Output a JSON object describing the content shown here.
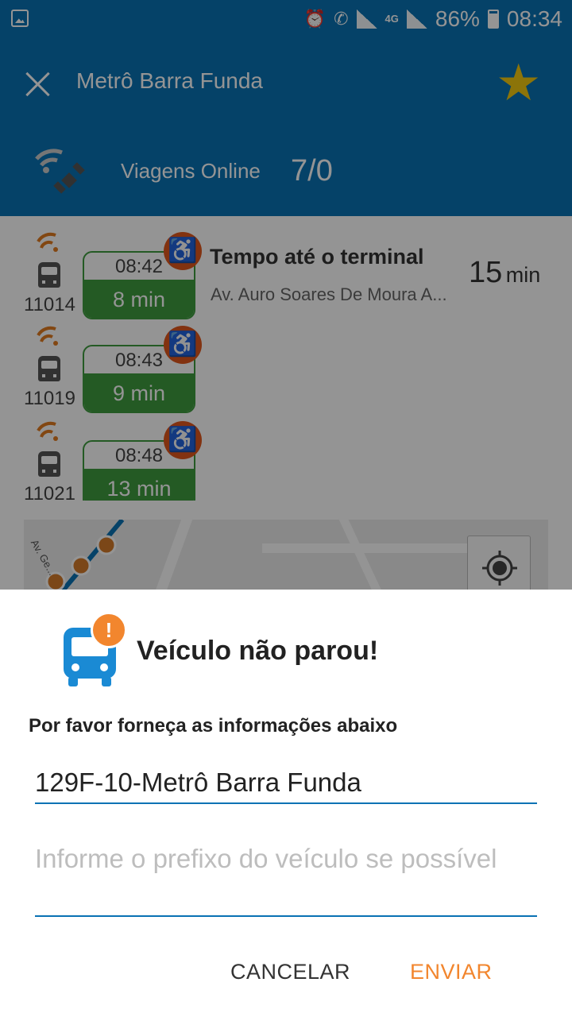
{
  "status_bar": {
    "battery": "86%",
    "time": "08:34",
    "network": "4G"
  },
  "header": {
    "title": "Metrô Barra Funda"
  },
  "online": {
    "label": "Viagens Online",
    "value": "7/0"
  },
  "trips": [
    {
      "bus": "11014",
      "time": "08:42",
      "eta": "8 min"
    },
    {
      "bus": "11019",
      "time": "08:43",
      "eta": "9 min"
    },
    {
      "bus": "11021",
      "time": "08:48",
      "eta": "13 min"
    }
  ],
  "terminal": {
    "title": "Tempo até o terminal",
    "address": "Av. Auro Soares De Moura A...",
    "minutes": "15",
    "unit": "min"
  },
  "map": {
    "street_label": "Av. Ge..."
  },
  "dialog": {
    "title": "Veículo não parou!",
    "subtitle": "Por favor forneça as informações abaixo",
    "line_value": "129F-10-Metrô Barra Funda",
    "prefix_placeholder": "Informe o prefixo do veículo se possível",
    "cancel_label": "CANCELAR",
    "send_label": "ENVIAR"
  },
  "colors": {
    "primary": "#0a72b4",
    "eta_green": "#3e9c3f",
    "accessibility_orange": "#e0561d",
    "accent_orange": "#f2862e",
    "star_yellow": "#f2c811"
  }
}
